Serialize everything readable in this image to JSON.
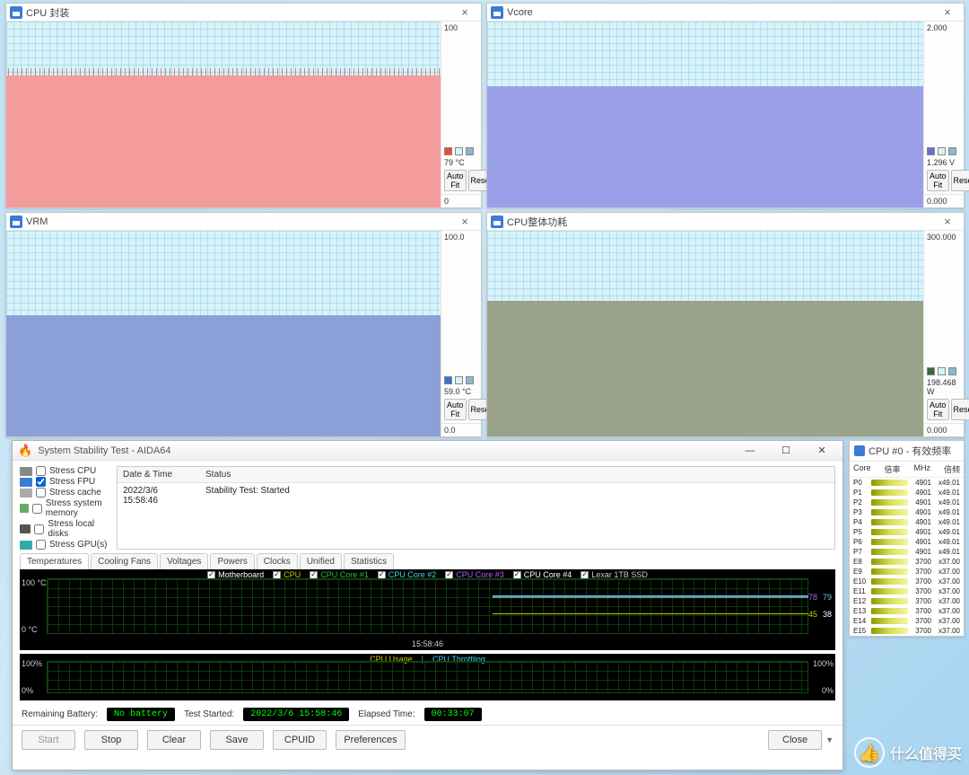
{
  "chart_data": [
    {
      "id": "cpu_pkg",
      "type": "area",
      "title": "CPU 封装",
      "ylim": [
        0,
        100
      ],
      "unit": "°C",
      "current_value": "79 °C",
      "approx_fill_pct": 71,
      "color": "#f49b9b"
    },
    {
      "id": "vcore",
      "type": "area",
      "title": "Vcore",
      "ylim": [
        0.0,
        2.0
      ],
      "unit": "V",
      "current_value": "1.296 V",
      "approx_fill_pct": 65,
      "color": "#9aa0e7"
    },
    {
      "id": "vrm",
      "type": "area",
      "title": "VRM",
      "ylim": [
        0.0,
        100.0
      ],
      "unit": "°C",
      "current_value": "59.0 °C",
      "approx_fill_pct": 59,
      "color": "#8ca0d8"
    },
    {
      "id": "cpu_power",
      "type": "area",
      "title": "CPU整体功耗",
      "ylim": [
        0.0,
        300.0
      ],
      "unit": "W",
      "current_value": "198.468 W",
      "approx_fill_pct": 66,
      "color": "#9aa28a"
    }
  ],
  "gwin_common": {
    "close_glyph": "×",
    "autofit": "Auto Fit",
    "reset": "Reset"
  },
  "graphs": {
    "cpu_pkg": {
      "title": "CPU 封装",
      "ymax": "100",
      "ymin": "0",
      "val": "79 °C",
      "fill_pct": 71,
      "color": "#f49b9b",
      "swatch": "#e74c3c",
      "noise": true
    },
    "vcore": {
      "title": "Vcore",
      "ymax": "2.000",
      "ymin": "0.000",
      "val": "1.296 V",
      "fill_pct": 65,
      "color": "#9aa0e7",
      "swatch": "#6a6ed0",
      "noise": false
    },
    "vrm": {
      "title": "VRM",
      "ymax": "100.0",
      "ymin": "0.0",
      "val": "59.0 °C",
      "fill_pct": 59,
      "color": "#8ca0d8",
      "swatch": "#3a6fcf",
      "noise": false
    },
    "cpu_power": {
      "title": "CPU整体功耗",
      "ymax": "300.000",
      "ymin": "0.000",
      "val": "198.468 W",
      "fill_pct": 66,
      "color": "#9aa28a",
      "swatch": "#3a6a3a",
      "noise": false
    }
  },
  "sst": {
    "title": "System Stability Test - AIDA64",
    "stress": {
      "cpu": "Stress CPU",
      "fpu": "Stress FPU",
      "cache": "Stress cache",
      "mem": "Stress system memory",
      "disk": "Stress local disks",
      "gpu": "Stress GPU(s)"
    },
    "log_head_dt": "Date & Time",
    "log_head_status": "Status",
    "log_row_dt": "2022/3/6 15:58:46",
    "log_row_status": "Stability Test: Started",
    "tabs": [
      "Temperatures",
      "Cooling Fans",
      "Voltages",
      "Powers",
      "Clocks",
      "Unified",
      "Statistics"
    ],
    "legend": [
      {
        "label": "Motherboard",
        "color": "#ffffff"
      },
      {
        "label": "CPU",
        "color": "#cccc00"
      },
      {
        "label": "CPU Core #1",
        "color": "#2fbf3a"
      },
      {
        "label": "CPU Core #2",
        "color": "#46d0e6"
      },
      {
        "label": "CPU Core #3",
        "color": "#b45cff"
      },
      {
        "label": "CPU Core #4",
        "color": "#ffffff"
      },
      {
        "label": "Lexar 1TB SSD",
        "color": "#cccccc"
      }
    ],
    "g1": {
      "ytop": "100 °C",
      "ybot": "0 °C",
      "xlab": "15:58:46",
      "r_high": "79",
      "r_high2": "78",
      "r_low": "38",
      "r_low2": "45"
    },
    "g2": {
      "ytop": "100%",
      "ybot": "0%",
      "legend_usage": "CPU Usage",
      "legend_throttle": "CPU Throttling"
    },
    "status": {
      "battery_lbl": "Remaining Battery:",
      "battery_val": "No battery",
      "started_lbl": "Test Started:",
      "started_val": "2022/3/6 15:58:46",
      "elapsed_lbl": "Elapsed Time:",
      "elapsed_val": "00:33:07"
    },
    "footer": {
      "start": "Start",
      "stop": "Stop",
      "clear": "Clear",
      "save": "Save",
      "cpuid": "CPUID",
      "prefs": "Preferences",
      "close": "Close"
    }
  },
  "freq": {
    "title": "CPU #0 - 有效频率",
    "head_core": "Core",
    "head_rate": "倍率",
    "head_mhz": "MHz",
    "head_mult": "倍频",
    "rows": [
      {
        "name": "P0",
        "mhz": "4901",
        "mult": "x49.01"
      },
      {
        "name": "P1",
        "mhz": "4901",
        "mult": "x49.01"
      },
      {
        "name": "P2",
        "mhz": "4901",
        "mult": "x49.01"
      },
      {
        "name": "P3",
        "mhz": "4901",
        "mult": "x49.01"
      },
      {
        "name": "P4",
        "mhz": "4901",
        "mult": "x49.01"
      },
      {
        "name": "P5",
        "mhz": "4901",
        "mult": "x49.01"
      },
      {
        "name": "P6",
        "mhz": "4901",
        "mult": "x49.01"
      },
      {
        "name": "P7",
        "mhz": "4901",
        "mult": "x49.01"
      },
      {
        "name": "E8",
        "mhz": "3700",
        "mult": "x37.00"
      },
      {
        "name": "E9",
        "mhz": "3700",
        "mult": "x37.00"
      },
      {
        "name": "E10",
        "mhz": "3700",
        "mult": "x37.00"
      },
      {
        "name": "E11",
        "mhz": "3700",
        "mult": "x37.00"
      },
      {
        "name": "E12",
        "mhz": "3700",
        "mult": "x37.00"
      },
      {
        "name": "E13",
        "mhz": "3700",
        "mult": "x37.00"
      },
      {
        "name": "E14",
        "mhz": "3700",
        "mult": "x37.00"
      },
      {
        "name": "E15",
        "mhz": "3700",
        "mult": "x37.00"
      }
    ]
  },
  "watermark": {
    "text": "什么值得买"
  }
}
